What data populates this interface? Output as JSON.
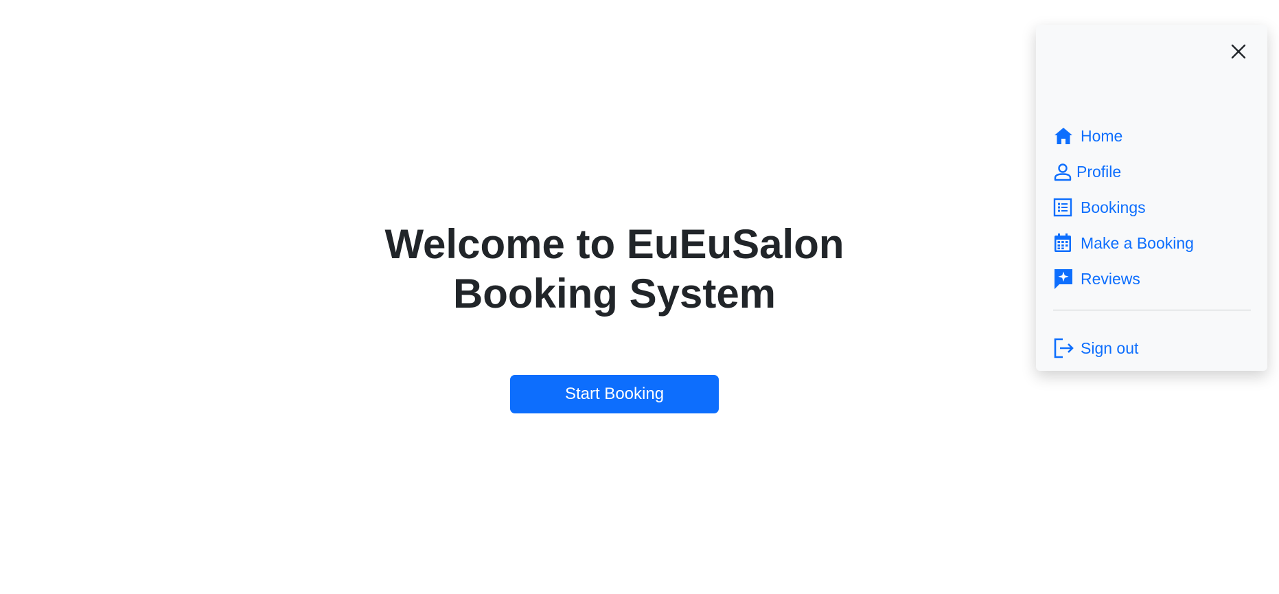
{
  "hero": {
    "title": "Welcome to EuEuSalon Booking System",
    "button_label": "Start Booking"
  },
  "sidebar": {
    "items": [
      {
        "label": "Home",
        "icon": "house-icon"
      },
      {
        "label": "Profile",
        "icon": "person-icon"
      },
      {
        "label": "Bookings",
        "icon": "list-icon"
      },
      {
        "label": "Make a Booking",
        "icon": "calendar-icon"
      },
      {
        "label": "Reviews",
        "icon": "review-icon"
      }
    ],
    "signout_label": "Sign out"
  },
  "colors": {
    "primary": "#0d6efd",
    "text": "#212529",
    "panel_bg": "#f8f9fa"
  }
}
